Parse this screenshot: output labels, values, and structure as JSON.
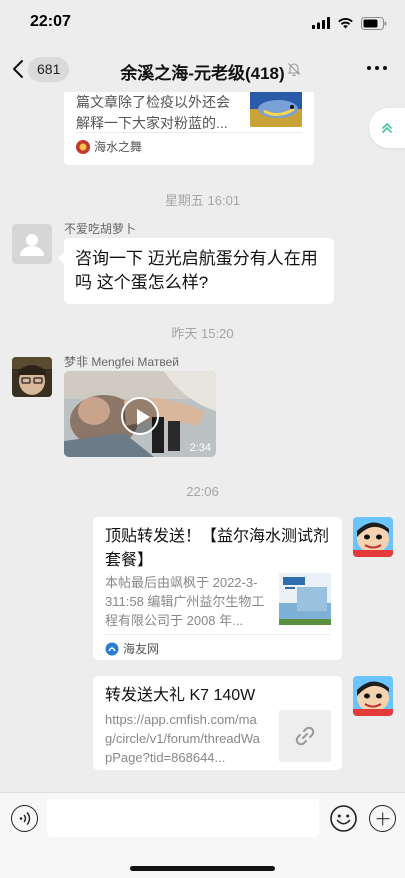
{
  "status": {
    "time": "22:07"
  },
  "nav": {
    "unread_count": "681",
    "title": "余溪之海-元老级(418)"
  },
  "messages": {
    "card1": {
      "desc": "篇文章除了检疫以外还会解释一下大家对粉蓝的...",
      "source": "海水之舞"
    },
    "time1": "星期五 16:01",
    "msg1": {
      "sender": "不爱吃胡萝卜",
      "text": "咨询一下  迈光启航蛋分有人在用吗 这个蛋怎么样?"
    },
    "time2": "昨天 15:20",
    "msg2": {
      "sender": "梦非 Mengfei Матвей",
      "video_duration": "2:34"
    },
    "time3": "22:06",
    "card2": {
      "title": "顶贴转发送！【益尔海水测试剂套餐】",
      "desc": "本帖最后由飒枫于 2022-3-311:58 编辑广州益尔生物工程有限公司于 2008 年...",
      "source": "海友网"
    },
    "card3": {
      "title": "转发送大礼 K7 140W",
      "desc": "https://app.cmfish.com/mag/circle/v1/forum/threadWapPage?tid=868644..."
    }
  },
  "input": {
    "placeholder": ""
  },
  "colors": {
    "background": "#ededed",
    "bubble": "#ffffff",
    "timestamp": "#a5a5a5",
    "float_button_icon": "#3cc4a0"
  }
}
